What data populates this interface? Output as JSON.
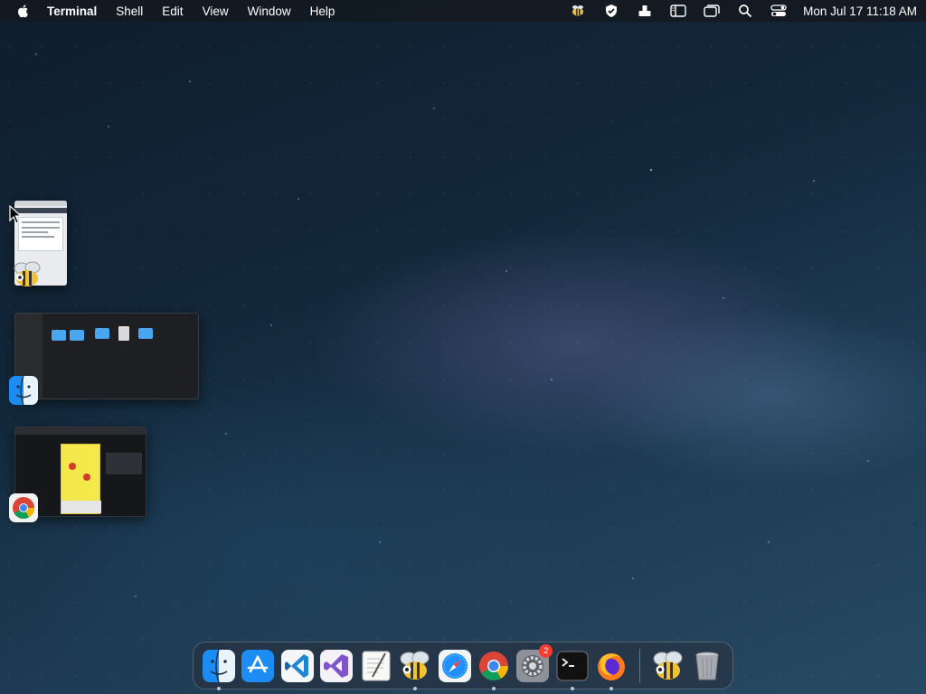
{
  "menubar": {
    "app_name": "Terminal",
    "items": [
      "Shell",
      "Edit",
      "View",
      "Window",
      "Help"
    ],
    "clock": "Mon Jul 17  11:18 AM",
    "status_icons": [
      "bee-icon",
      "vpn-shield-icon",
      "upload-tray-icon",
      "sidebar-icon",
      "window-stack-icon",
      "search-icon",
      "control-center-icon"
    ]
  },
  "stage_manager": [
    {
      "app": "Bee",
      "icon": "bee-icon"
    },
    {
      "app": "Finder",
      "icon": "finder-icon"
    },
    {
      "app": "Chrome",
      "icon": "chrome-icon"
    }
  ],
  "dock": {
    "items": [
      {
        "name": "finder",
        "running": true
      },
      {
        "name": "app-store",
        "running": false
      },
      {
        "name": "vscode",
        "running": false
      },
      {
        "name": "visual-studio",
        "running": false
      },
      {
        "name": "textedit",
        "running": false
      },
      {
        "name": "bee",
        "running": true
      },
      {
        "name": "safari",
        "running": false
      },
      {
        "name": "chrome",
        "running": true
      },
      {
        "name": "system-settings",
        "running": false,
        "badge": "2"
      },
      {
        "name": "terminal",
        "running": true
      },
      {
        "name": "firefox",
        "running": true
      }
    ],
    "recent": [
      {
        "name": "bee-recent",
        "running": false
      },
      {
        "name": "trash",
        "running": false
      }
    ]
  },
  "colors": {
    "accent_blue": "#1b8cf2",
    "badge_red": "#ff3b30",
    "menubar_bg": "#14181e"
  }
}
